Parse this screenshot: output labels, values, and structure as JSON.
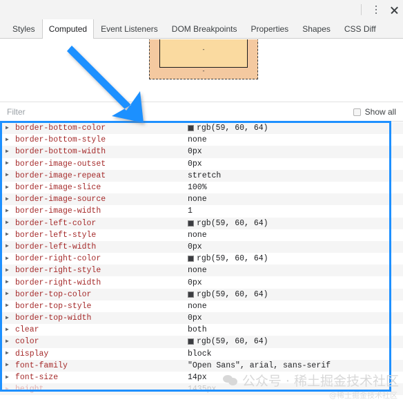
{
  "window": {
    "menu_icon": "vertical-dots-icon",
    "close_icon": "close-icon"
  },
  "tabs": [
    {
      "label": "Styles",
      "selected": false
    },
    {
      "label": "Computed",
      "selected": true
    },
    {
      "label": "Event Listeners",
      "selected": false
    },
    {
      "label": "DOM Breakpoints",
      "selected": false
    },
    {
      "label": "Properties",
      "selected": false
    },
    {
      "label": "Shapes",
      "selected": false
    },
    {
      "label": "CSS Diff",
      "selected": false
    }
  ],
  "box_model": {
    "margin_label": "-",
    "border_label": "-",
    "padding_label": "-",
    "content_label": "-",
    "colors": {
      "margin": "#f4c9a0",
      "padding": "#fadaa0",
      "content": "#bccb8f"
    }
  },
  "filter": {
    "placeholder": "Filter",
    "value": "",
    "show_all_label": "Show all",
    "show_all_checked": false
  },
  "accent_color": "#1e90ff",
  "properties": [
    {
      "name": "border-bottom-color",
      "value": "rgb(59, 60, 64)",
      "swatch": "#3b3c40"
    },
    {
      "name": "border-bottom-style",
      "value": "none",
      "swatch": null
    },
    {
      "name": "border-bottom-width",
      "value": "0px",
      "swatch": null
    },
    {
      "name": "border-image-outset",
      "value": "0px",
      "swatch": null
    },
    {
      "name": "border-image-repeat",
      "value": "stretch",
      "swatch": null
    },
    {
      "name": "border-image-slice",
      "value": "100%",
      "swatch": null
    },
    {
      "name": "border-image-source",
      "value": "none",
      "swatch": null
    },
    {
      "name": "border-image-width",
      "value": "1",
      "swatch": null
    },
    {
      "name": "border-left-color",
      "value": "rgb(59, 60, 64)",
      "swatch": "#3b3c40"
    },
    {
      "name": "border-left-style",
      "value": "none",
      "swatch": null
    },
    {
      "name": "border-left-width",
      "value": "0px",
      "swatch": null
    },
    {
      "name": "border-right-color",
      "value": "rgb(59, 60, 64)",
      "swatch": "#3b3c40"
    },
    {
      "name": "border-right-style",
      "value": "none",
      "swatch": null
    },
    {
      "name": "border-right-width",
      "value": "0px",
      "swatch": null
    },
    {
      "name": "border-top-color",
      "value": "rgb(59, 60, 64)",
      "swatch": "#3b3c40"
    },
    {
      "name": "border-top-style",
      "value": "none",
      "swatch": null
    },
    {
      "name": "border-top-width",
      "value": "0px",
      "swatch": null
    },
    {
      "name": "clear",
      "value": "both",
      "swatch": null
    },
    {
      "name": "color",
      "value": "rgb(59, 60, 64)",
      "swatch": "#3b3c40"
    },
    {
      "name": "display",
      "value": "block",
      "swatch": null
    },
    {
      "name": "font-family",
      "value": "\"Open Sans\", arial, sans-serif",
      "swatch": null
    },
    {
      "name": "font-size",
      "value": "14px",
      "swatch": null
    },
    {
      "name": "height",
      "value": "1435px",
      "swatch": null,
      "faded": true
    }
  ],
  "expander_glyph": "▶",
  "watermark": {
    "text": "公众号 · 稀土掘金技术社区",
    "sub": "@稀土掘金技术社区"
  }
}
